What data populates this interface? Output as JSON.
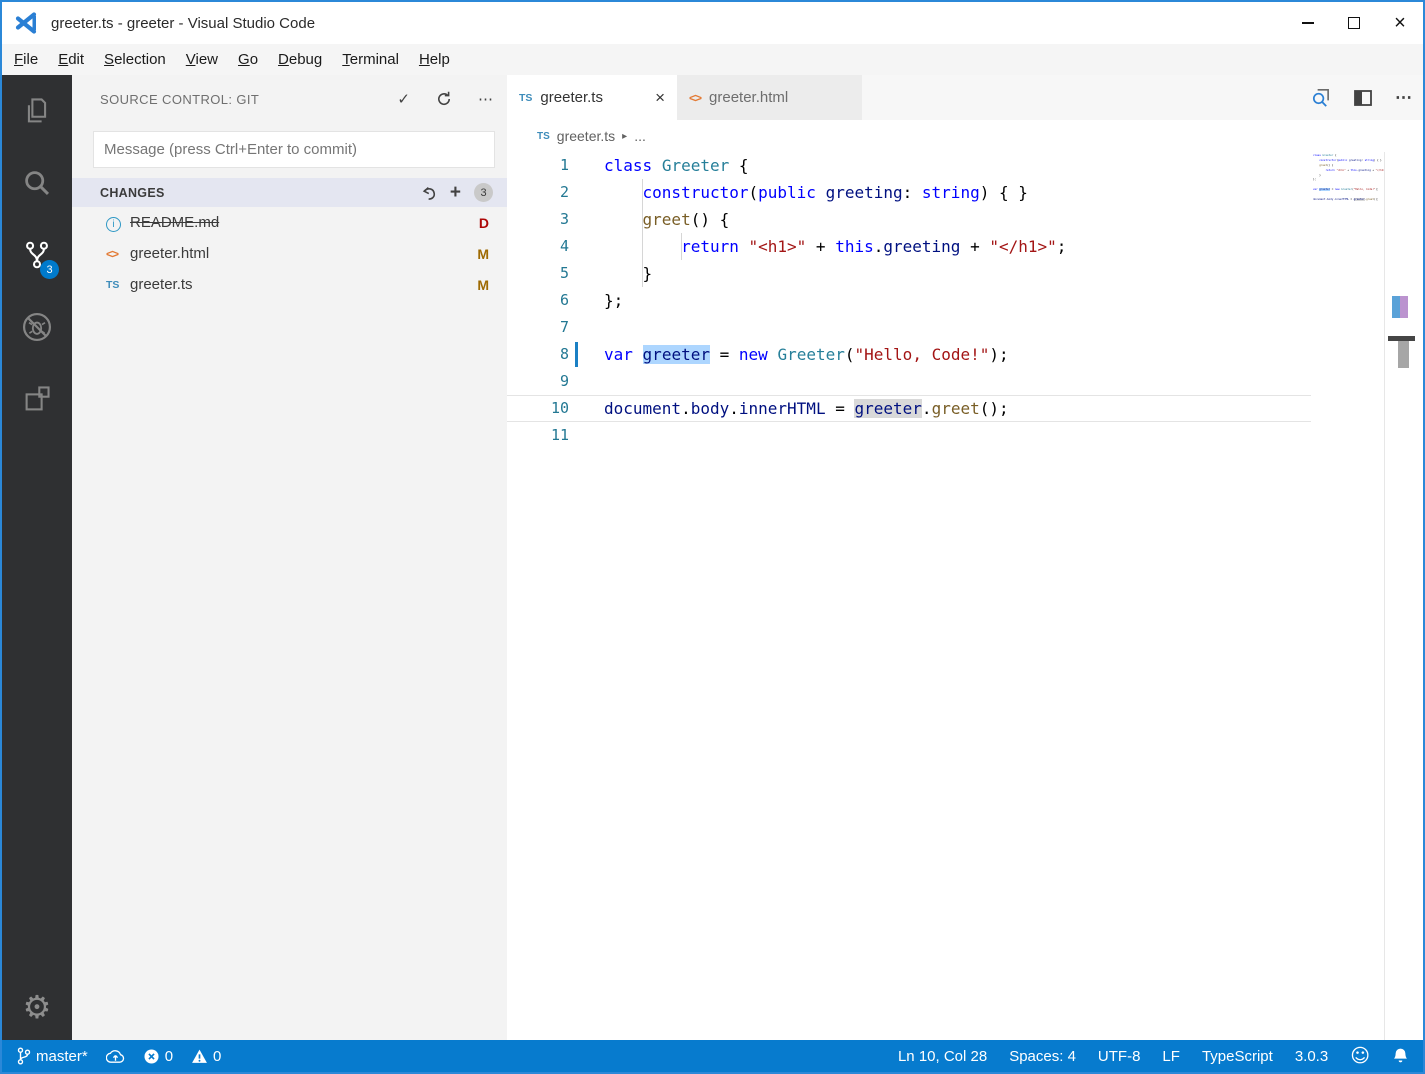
{
  "window": {
    "title": "greeter.ts - greeter - Visual Studio Code"
  },
  "icons": {
    "check": "✓",
    "more": "⋯",
    "plus": "+",
    "close": "×",
    "info": "i",
    "html": "<>",
    "ts": "TS",
    "breadcrumb_chevron": "▸",
    "breadcrumb_more": "...",
    "smiley": "☺",
    "gear": "⚙"
  },
  "menu": {
    "items": [
      "File",
      "Edit",
      "Selection",
      "View",
      "Go",
      "Debug",
      "Terminal",
      "Help"
    ]
  },
  "activity_bar": {
    "badge": "3"
  },
  "sidebar": {
    "header": {
      "title": "SOURCE CONTROL: GIT"
    },
    "commit_input": {
      "value": "",
      "placeholder": "Message (press Ctrl+Enter to commit)"
    },
    "changes": {
      "label": "CHANGES",
      "badge": "3",
      "items": [
        {
          "icon": "info",
          "name": "README.md",
          "status": "D",
          "deleted": true
        },
        {
          "icon": "html",
          "name": "greeter.html",
          "status": "M",
          "deleted": false
        },
        {
          "icon": "ts",
          "name": "greeter.ts",
          "status": "M",
          "deleted": false
        }
      ]
    }
  },
  "editor": {
    "tabs": [
      {
        "icon": "ts",
        "label": "greeter.ts",
        "active": true
      },
      {
        "icon": "html",
        "label": "greeter.html",
        "active": false
      }
    ],
    "breadcrumb": {
      "file": "greeter.ts",
      "more": "..."
    },
    "code": {
      "lines": [
        {
          "n": 1,
          "tokens": [
            {
              "c": "kw",
              "t": "class"
            },
            {
              "c": "pl",
              "t": " "
            },
            {
              "c": "type",
              "t": "Greeter"
            },
            {
              "c": "pl",
              "t": " {"
            }
          ]
        },
        {
          "n": 2,
          "tokens": [
            {
              "c": "pl",
              "t": "    "
            },
            {
              "c": "kw",
              "t": "constructor"
            },
            {
              "c": "pl",
              "t": "("
            },
            {
              "c": "kw",
              "t": "public"
            },
            {
              "c": "pl",
              "t": " "
            },
            {
              "c": "var",
              "t": "greeting"
            },
            {
              "c": "pl",
              "t": ": "
            },
            {
              "c": "kw",
              "t": "string"
            },
            {
              "c": "pl",
              "t": ") { }"
            }
          ]
        },
        {
          "n": 3,
          "tokens": [
            {
              "c": "pl",
              "t": "    "
            },
            {
              "c": "fn",
              "t": "greet"
            },
            {
              "c": "pl",
              "t": "() {"
            }
          ]
        },
        {
          "n": 4,
          "tokens": [
            {
              "c": "pl",
              "t": "        "
            },
            {
              "c": "kw",
              "t": "return"
            },
            {
              "c": "pl",
              "t": " "
            },
            {
              "c": "str",
              "t": "\"<h1>\""
            },
            {
              "c": "pl",
              "t": " + "
            },
            {
              "c": "kw",
              "t": "this"
            },
            {
              "c": "pl",
              "t": "."
            },
            {
              "c": "var",
              "t": "greeting"
            },
            {
              "c": "pl",
              "t": " + "
            },
            {
              "c": "str",
              "t": "\"</h1>\""
            },
            {
              "c": "pl",
              "t": ";"
            }
          ]
        },
        {
          "n": 5,
          "tokens": [
            {
              "c": "pl",
              "t": "    }"
            }
          ]
        },
        {
          "n": 6,
          "tokens": [
            {
              "c": "pl",
              "t": "};"
            }
          ]
        },
        {
          "n": 7,
          "tokens": []
        },
        {
          "n": 8,
          "tokens": [
            {
              "c": "kw",
              "t": "var"
            },
            {
              "c": "pl",
              "t": " "
            },
            {
              "c": "var",
              "t": "greeter",
              "hl": "blue"
            },
            {
              "c": "pl",
              "t": " = "
            },
            {
              "c": "kw",
              "t": "new"
            },
            {
              "c": "pl",
              "t": " "
            },
            {
              "c": "type",
              "t": "Greeter"
            },
            {
              "c": "pl",
              "t": "("
            },
            {
              "c": "str",
              "t": "\"Hello, Code!\""
            },
            {
              "c": "pl",
              "t": ");"
            }
          ]
        },
        {
          "n": 9,
          "tokens": []
        },
        {
          "n": 10,
          "current": true,
          "tokens": [
            {
              "c": "var",
              "t": "document"
            },
            {
              "c": "pl",
              "t": "."
            },
            {
              "c": "var",
              "t": "body"
            },
            {
              "c": "pl",
              "t": "."
            },
            {
              "c": "var",
              "t": "innerHTML"
            },
            {
              "c": "pl",
              "t": " = "
            },
            {
              "c": "var",
              "t": "greeter",
              "hl": "gray"
            },
            {
              "c": "pl",
              "t": "."
            },
            {
              "c": "fn",
              "t": "greet"
            },
            {
              "c": "pl",
              "t": "();"
            }
          ]
        },
        {
          "n": 11,
          "tokens": []
        }
      ]
    }
  },
  "status_bar": {
    "branch": "master*",
    "errors": "0",
    "warnings": "0",
    "right": [
      "Ln 10, Col 28",
      "Spaces: 4",
      "UTF-8",
      "LF",
      "TypeScript",
      "3.0.3"
    ]
  },
  "colors": {
    "accent": "#007acc",
    "window_border": "#2b88d8",
    "statusbar": "#077bce",
    "badge": "#007acc",
    "modified": "#9e6a03",
    "deleted": "#ad0707",
    "keyword": "#0000ff",
    "type": "#267f99",
    "string": "#a31515",
    "variable": "#001080",
    "function": "#795e26",
    "line_number": "#237893",
    "selection_highlight": "#add6ff",
    "word_highlight": "#d9d9d9"
  }
}
